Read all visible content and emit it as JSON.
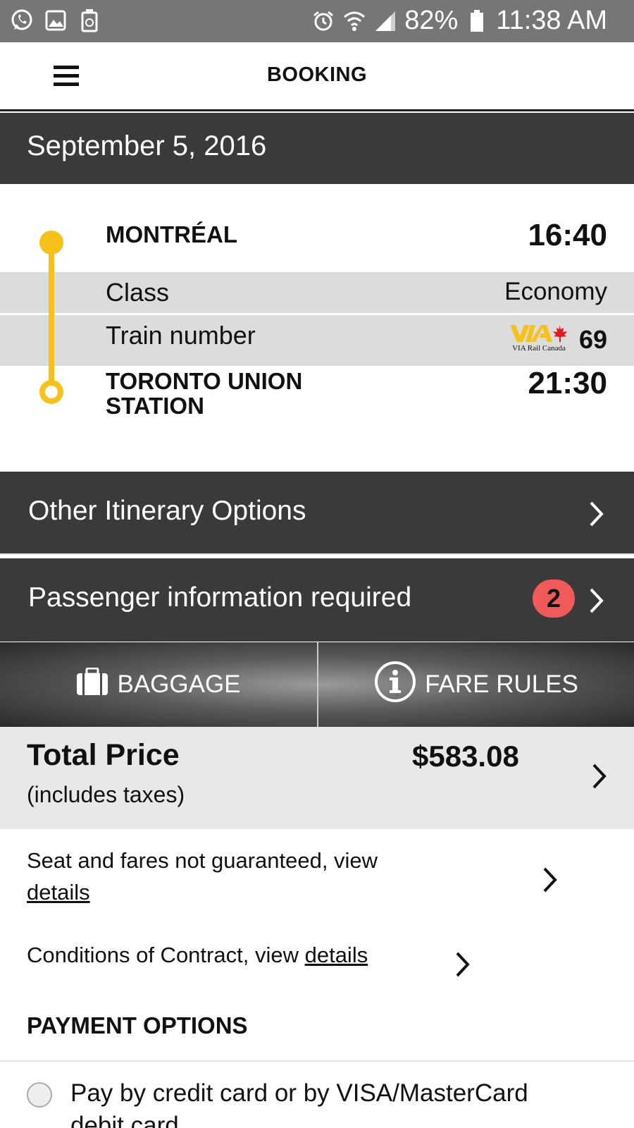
{
  "status_bar": {
    "battery": "82%",
    "time": "11:38 AM",
    "icons": [
      "whatsapp-icon",
      "gallery-icon",
      "recycle-icon",
      "alarm-icon",
      "wifi-icon",
      "signal-icon",
      "battery-icon"
    ]
  },
  "header": {
    "title": "BOOKING",
    "menu_icon": "hamburger-menu-icon"
  },
  "date": "September 5, 2016",
  "itinerary": {
    "departure_station": "MONTRÉAL",
    "departure_time": "16:40",
    "class_label": "Class",
    "class_value": "Economy",
    "train_label": "Train number",
    "train_brand": "VIA Rail Canada",
    "train_number": "69",
    "arrival_station_line1": "TORONTO UNION",
    "arrival_station_line2": "STATION",
    "arrival_time": "21:30",
    "accent_color": "#f6c11b"
  },
  "rows": {
    "other_itinerary": "Other Itinerary Options",
    "passenger_info": "Passenger information required",
    "passenger_badge": "2"
  },
  "buttons": {
    "baggage": "BAGGAGE",
    "fare_rules": "FARE RULES"
  },
  "price": {
    "title": "Total Price",
    "subtitle": "(includes taxes)",
    "amount": "$583.08"
  },
  "notices": {
    "seat_text": "Seat and fares not guaranteed, view",
    "seat_link": "details",
    "contract_text": "Conditions of Contract, view",
    "contract_link": "details"
  },
  "payment": {
    "title": "PAYMENT OPTIONS",
    "option_credit": "Pay by credit card or by VISA/MasterCard debit card"
  }
}
